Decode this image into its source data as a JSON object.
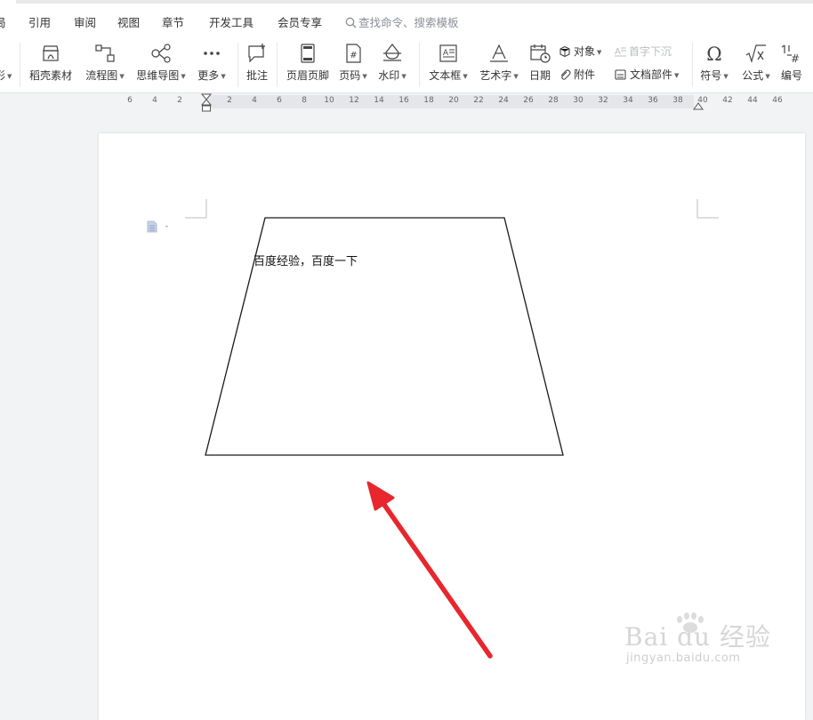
{
  "menu": {
    "items": [
      "局",
      "引用",
      "审阅",
      "视图",
      "章节",
      "开发工具",
      "会员专享"
    ],
    "search_placeholder": "查找命令、搜索模板"
  },
  "ribbon": {
    "partial_label": "形",
    "buttons": [
      {
        "label": "稻壳素材",
        "icon": "daoke-materials-icon"
      },
      {
        "label": "流程图",
        "icon": "flowchart-icon"
      },
      {
        "label": "思维导图",
        "icon": "mindmap-icon"
      },
      {
        "label": "更多",
        "icon": "more-icon"
      },
      {
        "label": "批注",
        "icon": "comment-icon"
      },
      {
        "label": "页眉页脚",
        "icon": "header-footer-icon"
      },
      {
        "label": "页码",
        "icon": "page-number-icon"
      },
      {
        "label": "水印",
        "icon": "watermark-icon"
      },
      {
        "label": "文本框",
        "icon": "textbox-icon"
      },
      {
        "label": "艺术字",
        "icon": "wordart-icon"
      },
      {
        "label": "日期",
        "icon": "date-icon"
      },
      {
        "label": "符号",
        "icon": "omega-symbol-icon"
      },
      {
        "label": "公式",
        "icon": "formula-icon"
      },
      {
        "label": "编号",
        "icon": "numbering-icon"
      }
    ],
    "object_label": "对象",
    "attachment_label": "附件",
    "dropcap_label": "首字下沉",
    "doc_parts_label": "文档部件"
  },
  "ruler": {
    "ticks": [
      "6",
      "4",
      "2",
      "2",
      "4",
      "6",
      "8",
      "10",
      "12",
      "14",
      "16",
      "18",
      "20",
      "22",
      "24",
      "26",
      "28",
      "30",
      "32",
      "34",
      "36",
      "38",
      "40",
      "42",
      "44",
      "46"
    ]
  },
  "document": {
    "text": "百度经验，百度一下"
  },
  "watermark": {
    "brand": "Bai du 经验",
    "url": "jingyan.baidu.com"
  },
  "colors": {
    "arrow": "#e8262d",
    "ribbon_bg": "#ffffff",
    "workspace_bg": "#f2f3f5"
  }
}
